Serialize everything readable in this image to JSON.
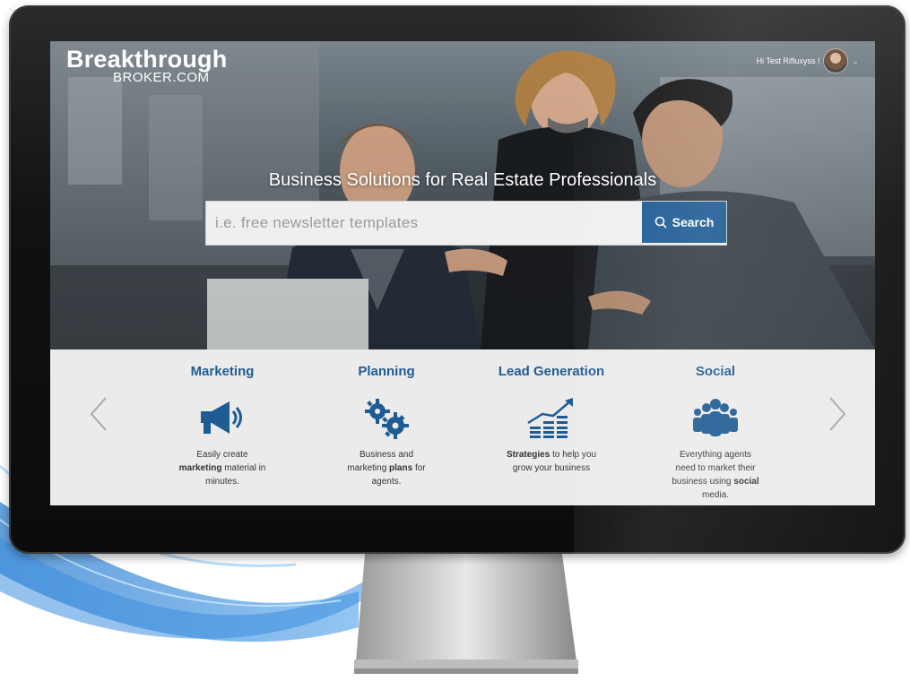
{
  "brand": {
    "name": "Breakthrough",
    "sub": "BROKER.COM"
  },
  "user": {
    "greeting": "Hi Test Rifluxyss !",
    "avatar_icon": "user-avatar",
    "menu_icon": "chevron-down-icon"
  },
  "hero": {
    "headline": "Business Solutions for Real Estate Professionals",
    "search_placeholder": "i.e. free newsletter templates",
    "search_label": "Search"
  },
  "categories": [
    {
      "title": "Marketing",
      "icon": "megaphone-icon",
      "desc": [
        "Easily create",
        "marketing",
        "material in",
        "minutes."
      ]
    },
    {
      "title": "Planning",
      "icon": "gears-icon",
      "desc": [
        "Business and",
        "marketing",
        "plans",
        "for",
        "agents."
      ]
    },
    {
      "title": "Lead Generation",
      "icon": "growth-chart-icon",
      "desc": [
        "Strategies",
        "to help you",
        "grow your business"
      ]
    },
    {
      "title": "Social",
      "icon": "people-group-icon",
      "desc": [
        "Everything agents",
        "need to market their",
        "business using",
        "social",
        "media."
      ]
    }
  ],
  "nav": {
    "prev_icon": "chevron-left-icon",
    "next_icon": "chevron-right-icon"
  },
  "colors": {
    "accent": "#1f5c94",
    "panel": "#ebebeb"
  }
}
